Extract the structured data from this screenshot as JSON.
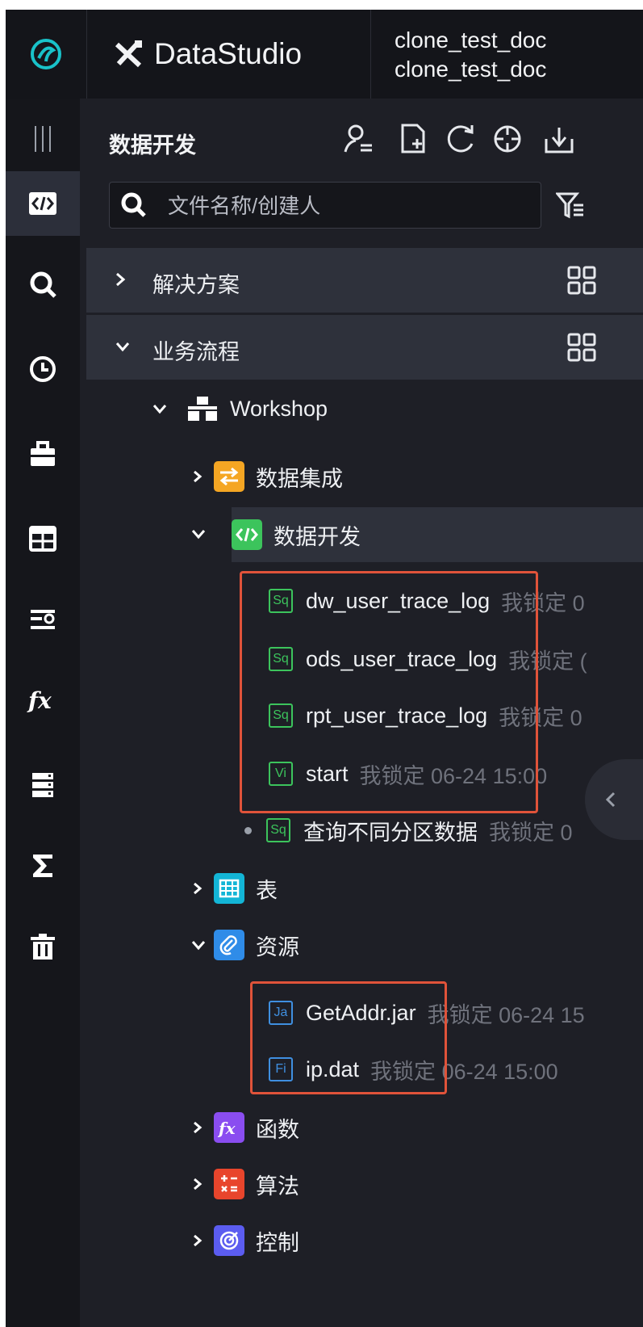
{
  "topbar": {
    "app_name": "DataStudio",
    "project_line1": "clone_test_doc",
    "project_line2": "clone_test_doc"
  },
  "panel": {
    "title": "数据开发",
    "search_placeholder": "文件名称/创建人"
  },
  "sections": [
    {
      "label": "解决方案",
      "expanded": false
    },
    {
      "label": "业务流程",
      "expanded": true
    }
  ],
  "workflow": {
    "name": "Workshop",
    "groups": {
      "integration": "数据集成",
      "development": "数据开发",
      "table": "表",
      "resource": "资源",
      "function": "函数",
      "algorithm": "算法",
      "control": "控制"
    }
  },
  "dev_nodes": [
    {
      "tag": "Sq",
      "name": "dw_user_trace_log",
      "meta": "我锁定 0"
    },
    {
      "tag": "Sq",
      "name": "ods_user_trace_log",
      "meta": "我锁定 ("
    },
    {
      "tag": "Sq",
      "name": "rpt_user_trace_log",
      "meta": "我锁定 0"
    },
    {
      "tag": "Vi",
      "name": "start",
      "meta": "我锁定 06-24 15:00"
    },
    {
      "tag": "Sq",
      "name": "查询不同分区数据",
      "meta": "我锁定 0"
    }
  ],
  "resource_nodes": [
    {
      "tag": "Ja",
      "name": "GetAddr.jar",
      "meta": "我锁定 06-24 15"
    },
    {
      "tag": "Fi",
      "name": "ip.dat",
      "meta": "我锁定 06-24 15:00"
    }
  ],
  "colors": {
    "background": "#1e1f26",
    "accent_green": "#3cc45c",
    "accent_blue": "#3f8fe0",
    "highlight_red": "#e0533a",
    "integration_orange": "#f5a623",
    "function_purple": "#8a4df0",
    "algorithm_red": "#e8452c",
    "control_indigo": "#5b5cf0"
  }
}
